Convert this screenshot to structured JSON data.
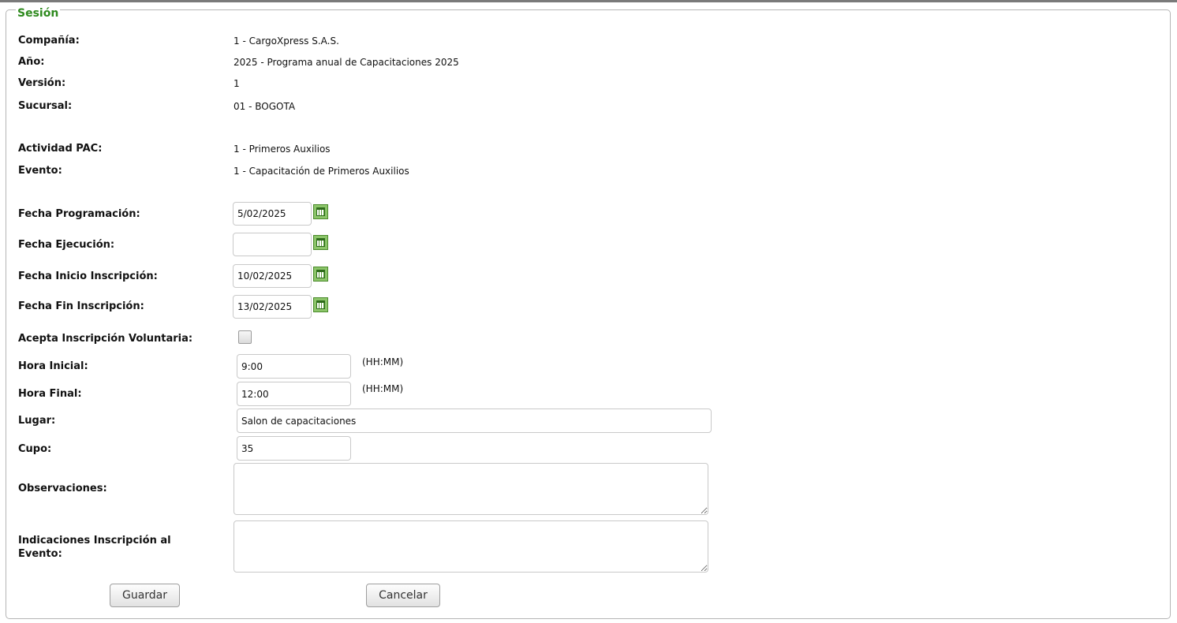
{
  "section": {
    "title": "Sesión"
  },
  "fields": {
    "company": {
      "label": "Compañía:",
      "value": "1 - CargoXpress S.A.S."
    },
    "year": {
      "label": "Año:",
      "value": "2025 - Programa anual de Capacitaciones 2025"
    },
    "version": {
      "label": "Versión:",
      "value": "1"
    },
    "branch": {
      "label": "Sucursal:",
      "value": "01 - BOGOTA"
    },
    "activity": {
      "label": "Actividad PAC:",
      "value": "1 - Primeros Auxilios"
    },
    "event": {
      "label": "Evento:",
      "value": "1 - Capacitación de Primeros Auxilios"
    },
    "schedule_date": {
      "label": "Fecha Programación:",
      "value": "5/02/2025"
    },
    "execution_date": {
      "label": "Fecha Ejecución:",
      "value": ""
    },
    "enroll_start": {
      "label": "Fecha Inicio Inscripción:",
      "value": "10/02/2025"
    },
    "enroll_end": {
      "label": "Fecha Fin Inscripción:",
      "value": "13/02/2025"
    },
    "voluntary": {
      "label": "Acepta Inscripción Voluntaria:",
      "checked": false
    },
    "start_time": {
      "label": "Hora Inicial:",
      "value": "9:00",
      "hint": "(HH:MM)"
    },
    "end_time": {
      "label": "Hora Final:",
      "value": "12:00",
      "hint": "(HH:MM)"
    },
    "place": {
      "label": "Lugar:",
      "value": "Salon de capacitaciones"
    },
    "quota": {
      "label": "Cupo:",
      "value": "35"
    },
    "observations": {
      "label": "Observaciones:",
      "value": ""
    },
    "instructions": {
      "label": "Indicaciones Inscripción al Evento:",
      "value": ""
    }
  },
  "buttons": {
    "save": "Guardar",
    "cancel": "Cancelar"
  },
  "icons": {
    "calendar": "calendar-icon"
  },
  "colors": {
    "legend": "#2e8a1e",
    "calendar_icon": "#8cc56a"
  }
}
